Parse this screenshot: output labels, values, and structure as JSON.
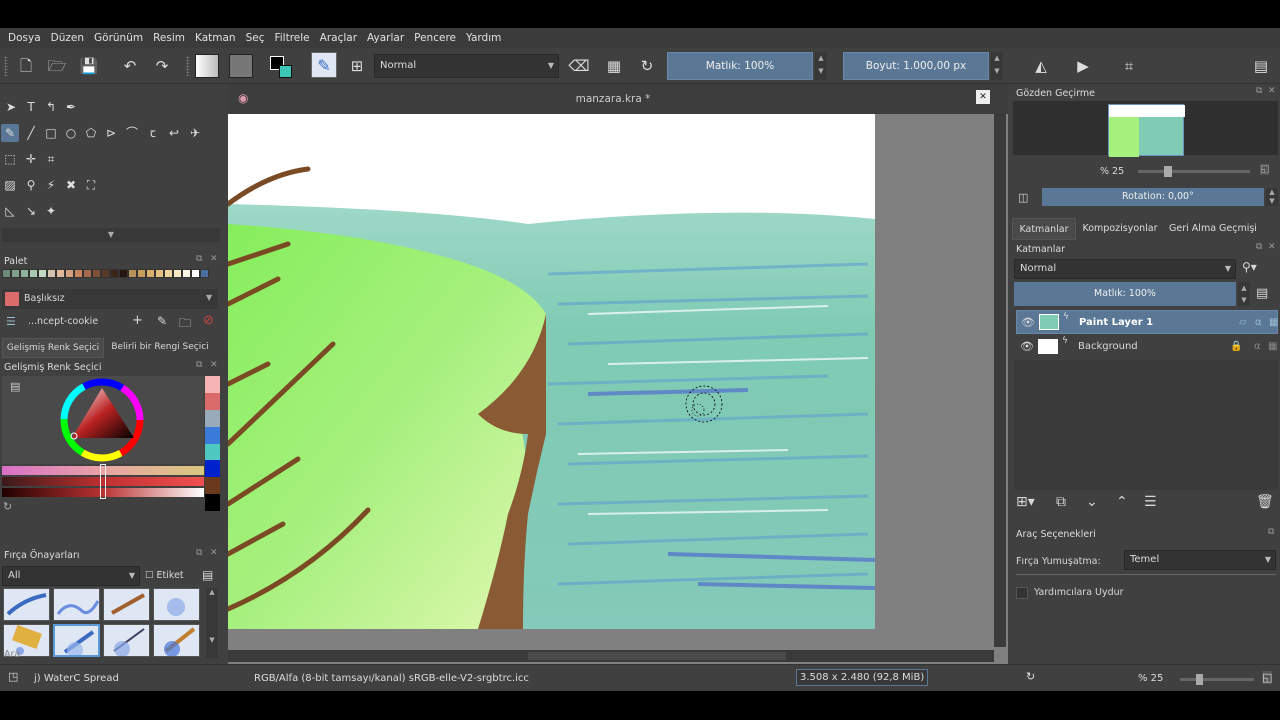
{
  "menu": [
    "Dosya",
    "Düzen",
    "Görünüm",
    "Resim",
    "Katman",
    "Seç",
    "Filtrele",
    "Araçlar",
    "Ayarlar",
    "Pencere",
    "Yardım"
  ],
  "toolbar": {
    "blend_mode": "Normal",
    "opacity_label": "Matlık: 100%",
    "size_label": "Boyut: 1.000,00 px"
  },
  "document": {
    "title": "manzara.kra *"
  },
  "left": {
    "palette_title": "Palet",
    "palette_name": "Başlıksız",
    "palette_set": "...ncept-cookie",
    "color_tabs": [
      "Gelişmiş Renk Seçici",
      "Belirli bir Rengi Seçici"
    ],
    "color_selector_title": "Gelişmiş Renk Seçici",
    "presets_title": "Fırça Önayarları",
    "preset_filter": "All",
    "tag_label": "Etiket",
    "search_placeholder": "Ara",
    "palette_colors": [
      "#6d8a78",
      "#7fa08a",
      "#8cb39a",
      "#a9c7b1",
      "#c5d9c4",
      "#d7c4ad",
      "#e1b99b",
      "#d69f7e",
      "#c8845e",
      "#a5694c",
      "#7f4f37",
      "#5a3827",
      "#3b2519",
      "#23170f",
      "#b6925a",
      "#c79d5c",
      "#d6ad6a",
      "#e3c07f",
      "#efd69e",
      "#f5e8c4",
      "#fbf5e6",
      "#ffffff",
      "#4b6f9c"
    ]
  },
  "right": {
    "overview_title": "Gözden Geçirme",
    "zoom_label": "% 25",
    "rotation_label": "Rotation: 0,00°",
    "tabs": [
      "Katmanlar",
      "Kompozisyonlar",
      "Geri Alma Geçmişi"
    ],
    "layers_title": "Katmanlar",
    "layer_blend": "Normal",
    "layer_opacity": "Matlık:  100%",
    "layers": [
      {
        "name": "Paint Layer 1",
        "selected": true,
        "locked": false
      },
      {
        "name": "Background",
        "selected": false,
        "locked": true
      }
    ],
    "tool_options_title": "Araç Seçenekleri",
    "smoothing_label": "Fırça Yumuşatma:",
    "smoothing_value": "Temel",
    "snap_label": "Yardımcılara Uydur"
  },
  "status": {
    "brush": "j) WaterC Spread",
    "colorspace": "RGB/Alfa (8-bit tamsayı/kanal)  sRGB-elle-V2-srgbtrc.icc",
    "dimensions": "3.508 x 2.480 (92,8 MiB)",
    "zoom": "% 25"
  },
  "colors": {
    "foreground": "#000000",
    "background": "#ffffff",
    "accent": "#5a7896"
  }
}
